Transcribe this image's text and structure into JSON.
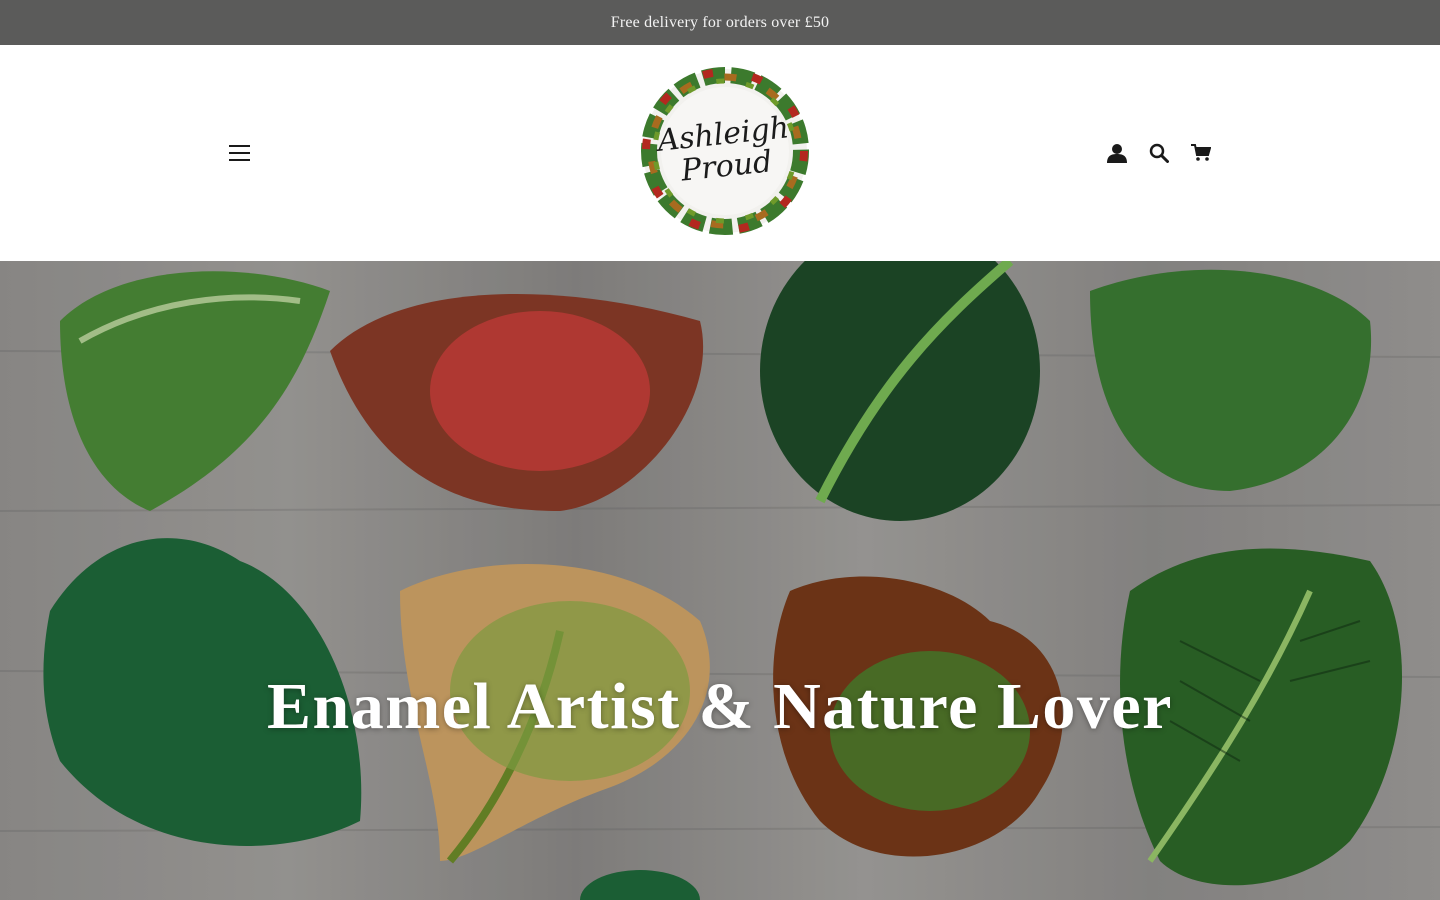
{
  "announcement": {
    "text": "Free delivery for orders over £50"
  },
  "header": {
    "logo": {
      "line1": "Ashleigh",
      "line2": "Proud"
    },
    "icons": [
      "menu-icon",
      "account-icon",
      "search-icon",
      "cart-icon"
    ]
  },
  "hero": {
    "title": "Enamel Artist & Nature Lover"
  },
  "colors": {
    "announcement_bg": "#5b5b5a",
    "announcement_text": "#f3f3f3",
    "header_bg": "#ffffff",
    "hero_title": "#ffffff"
  }
}
